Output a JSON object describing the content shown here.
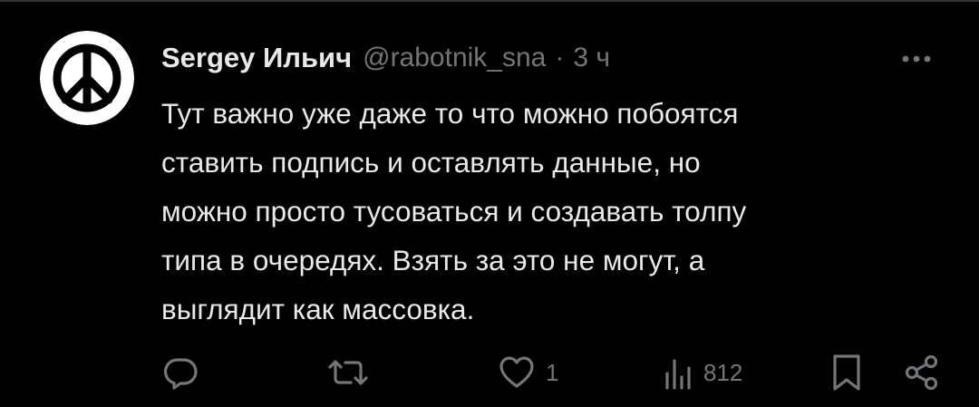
{
  "colors": {
    "background": "#000000",
    "text_primary": "#e7e9ea",
    "text_secondary": "#71767b",
    "divider": "#2f3336"
  },
  "tweet": {
    "author": {
      "display_name": "Sergey Ильич",
      "handle": "@rabotnik_sna",
      "avatar_icon": "peace-sign-icon"
    },
    "separator": "·",
    "timestamp": "3 ч",
    "text": "Тут важно уже даже то что можно побоятся\nставить подпись и оставлять данные, но\nможно просто тусоваться и создавать толпу\nтипа в очередях. Взять за это не могут, а\nвыглядит как массовка.",
    "actions": {
      "reply": {
        "icon": "reply-icon",
        "count": ""
      },
      "repost": {
        "icon": "repost-icon",
        "count": ""
      },
      "like": {
        "icon": "heart-icon",
        "count": "1"
      },
      "views": {
        "icon": "views-icon",
        "count": "812"
      },
      "bookmark": {
        "icon": "bookmark-icon"
      },
      "share": {
        "icon": "share-icon"
      }
    },
    "more_icon": "more-icon"
  }
}
